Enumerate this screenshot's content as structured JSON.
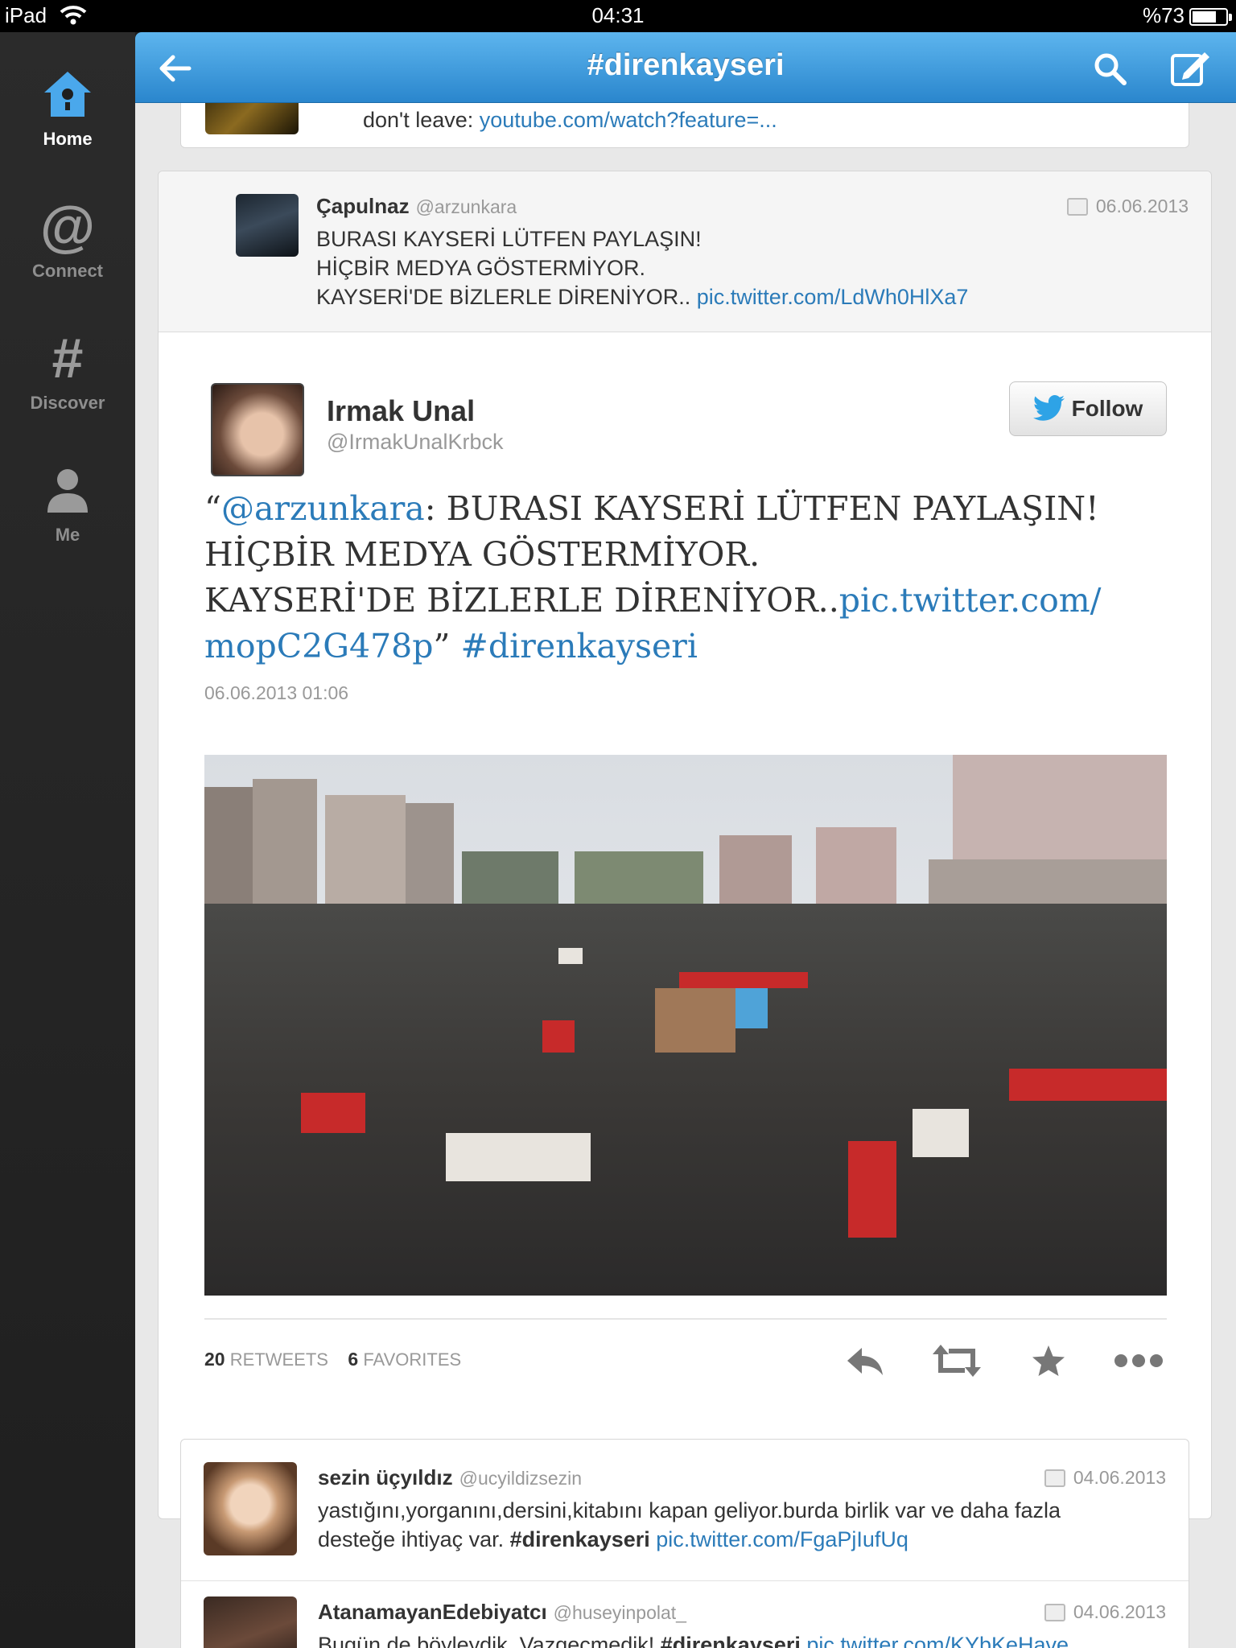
{
  "status_bar": {
    "device": "iPad",
    "time": "04:31",
    "battery": "%73",
    "battery_level": 0.73
  },
  "nav": [
    {
      "label": "Home",
      "icon": "home-icon",
      "active": true
    },
    {
      "label": "Connect",
      "icon": "at-icon"
    },
    {
      "label": "Discover",
      "icon": "hash-icon"
    },
    {
      "label": "Me",
      "icon": "person-icon"
    }
  ],
  "header": {
    "title": "#direnkayseri"
  },
  "tweets": {
    "cut_top": {
      "text": "don't leave: ",
      "link": "youtube.com/watch?feature=..."
    },
    "parent": {
      "name": "Çapulnaz",
      "handle": "@arzunkara",
      "date": "06.06.2013",
      "line1": "BURASI KAYSERİ LÜTFEN PAYLAŞIN!",
      "line2": "HİÇBİR MEDYA GÖSTERMİYOR.",
      "line3": "KAYSERİ'DE BİZLERLE DİRENİYOR.. ",
      "link": "pic.twitter.com/LdWh0HlXa7"
    },
    "detail": {
      "name": "Irmak Unal",
      "handle": "@IrmakUnalKrbck",
      "follow_label": "Follow",
      "quote_open": "“",
      "mention": "@arzunkara",
      "part1": ": BURASI KAYSERİ LÜTFEN PAYLAŞIN!",
      "part2": "HİÇBİR MEDYA GÖSTERMİYOR.",
      "part3": "KAYSERİ'DE BİZLERLE DİRENİYOR..",
      "link1": "pic.twitter.com/",
      "link2": "mopC2G478p",
      "quote_close": "” ",
      "hashtag": "#direnkayseri",
      "timestamp": "06.06.2013 01:06",
      "retweets_count": "20",
      "retweets_label": "RETWEETS",
      "favorites_count": "6",
      "favorites_label": "FAVORITES"
    },
    "reply1": {
      "name": "sezin üçyıldız",
      "handle": "@ucyildizsezin",
      "date": "04.06.2013",
      "line1": "yastığını,yorganını,dersini,kitabını kapan geliyor.burda birlik var ve daha fazla",
      "line2": "desteğe ihtiyaç var.  ",
      "hashtag": "#direnkayseri",
      "link": "pic.twitter.com/FgaPjIufUq"
    },
    "reply2": {
      "name": "AtanamayanEdebiyatcı",
      "handle": "@huseyinpolat_",
      "date": "04.06.2013",
      "text": "Bugün de böyleydik. Vazgeçmedik! ",
      "hashtag": "#direnkayseri",
      "link": "pic.twitter.com/KYbKeHave"
    }
  }
}
